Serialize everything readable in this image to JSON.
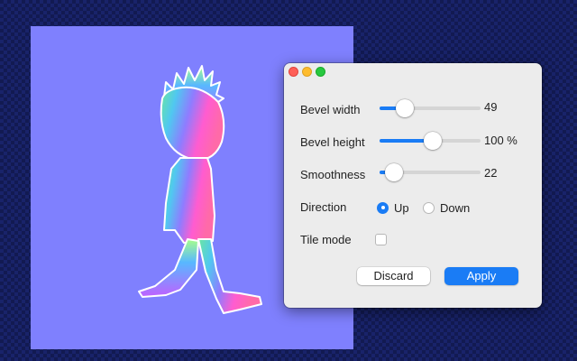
{
  "canvas": {
    "background_color": "#7f80fe",
    "content": "normal-map character figure"
  },
  "panel": {
    "window_controls": [
      "close",
      "minimize",
      "maximize"
    ],
    "sliders": [
      {
        "label": "Bevel width",
        "value_text": "49",
        "level_percent": 25
      },
      {
        "label": "Bevel height",
        "value_text": "100 %",
        "level_percent": 53
      },
      {
        "label": "Smoothness",
        "value_text": "22",
        "level_percent": 14
      }
    ],
    "direction": {
      "label": "Direction",
      "options": [
        "Up",
        "Down"
      ],
      "selected": "Up"
    },
    "tile_mode": {
      "label": "Tile mode",
      "checked": false
    },
    "buttons": {
      "discard": "Discard",
      "apply": "Apply"
    },
    "accent_color": "#1a7cf5"
  }
}
